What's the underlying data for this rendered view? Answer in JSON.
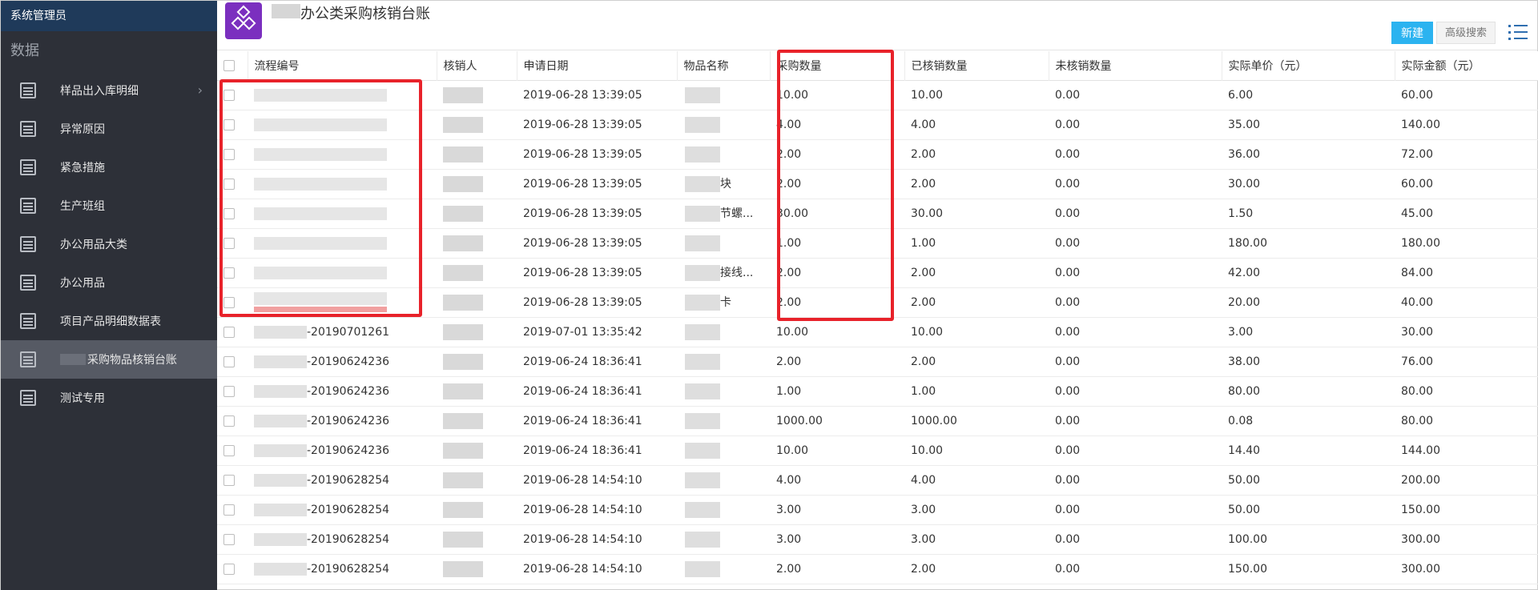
{
  "sidebar": {
    "user": "系统管理员",
    "section": "数据",
    "items": [
      {
        "label": "样品出入库明细",
        "has_arrow": true
      },
      {
        "label": "异常原因"
      },
      {
        "label": "紧急措施"
      },
      {
        "label": "生产班组"
      },
      {
        "label": "办公用品大类"
      },
      {
        "label": "办公用品"
      },
      {
        "label": "项目产品明细数据表"
      },
      {
        "label": "采购物品核销台账",
        "active": true
      },
      {
        "label": "测试专用"
      }
    ]
  },
  "header": {
    "title": "办公类采购核销台账",
    "new_label": "新建",
    "advanced_search_label": "高级搜索",
    "accent": "#2bb3f0",
    "logo_color": "#7b2fbf"
  },
  "table": {
    "columns": [
      "流程编号",
      "核销人",
      "申请日期",
      "物品名称",
      "采购数量",
      "已核销数量",
      "未核销数量",
      "实际单价（元）",
      "实际金额（元）"
    ],
    "rows": [
      {
        "code": "",
        "date": "2019-06-28 13:39:05",
        "item": "",
        "qty": "10.00",
        "done": "10.00",
        "pending": "0.00",
        "price": "6.00",
        "amount": "60.00"
      },
      {
        "code": "",
        "date": "2019-06-28 13:39:05",
        "item": "",
        "qty": "4.00",
        "done": "4.00",
        "pending": "0.00",
        "price": "35.00",
        "amount": "140.00"
      },
      {
        "code": "",
        "date": "2019-06-28 13:39:05",
        "item": "",
        "qty": "2.00",
        "done": "2.00",
        "pending": "0.00",
        "price": "36.00",
        "amount": "72.00"
      },
      {
        "code": "",
        "date": "2019-06-28 13:39:05",
        "item": "块",
        "qty": "2.00",
        "done": "2.00",
        "pending": "0.00",
        "price": "30.00",
        "amount": "60.00"
      },
      {
        "code": "",
        "date": "2019-06-28 13:39:05",
        "item": "节螺...",
        "qty": "30.00",
        "done": "30.00",
        "pending": "0.00",
        "price": "1.50",
        "amount": "45.00"
      },
      {
        "code": "",
        "date": "2019-06-28 13:39:05",
        "item": "",
        "qty": "1.00",
        "done": "1.00",
        "pending": "0.00",
        "price": "180.00",
        "amount": "180.00"
      },
      {
        "code": "",
        "date": "2019-06-28 13:39:05",
        "item": "接线...",
        "qty": "2.00",
        "done": "2.00",
        "pending": "0.00",
        "price": "42.00",
        "amount": "84.00"
      },
      {
        "code": "",
        "date": "2019-06-28 13:39:05",
        "item": "卡",
        "qty": "2.00",
        "done": "2.00",
        "pending": "0.00",
        "price": "20.00",
        "amount": "40.00"
      },
      {
        "code": "-20190701261",
        "date": "2019-07-01 13:35:42",
        "item": "",
        "qty": "10.00",
        "done": "10.00",
        "pending": "0.00",
        "price": "3.00",
        "amount": "30.00"
      },
      {
        "code": "-20190624236",
        "date": "2019-06-24 18:36:41",
        "item": "",
        "qty": "2.00",
        "done": "2.00",
        "pending": "0.00",
        "price": "38.00",
        "amount": "76.00"
      },
      {
        "code": "-20190624236",
        "date": "2019-06-24 18:36:41",
        "item": "",
        "qty": "1.00",
        "done": "1.00",
        "pending": "0.00",
        "price": "80.00",
        "amount": "80.00"
      },
      {
        "code": "-20190624236",
        "date": "2019-06-24 18:36:41",
        "item": "",
        "qty": "1000.00",
        "done": "1000.00",
        "pending": "0.00",
        "price": "0.08",
        "amount": "80.00"
      },
      {
        "code": "-20190624236",
        "date": "2019-06-24 18:36:41",
        "item": "",
        "qty": "10.00",
        "done": "10.00",
        "pending": "0.00",
        "price": "14.40",
        "amount": "144.00"
      },
      {
        "code": "-20190628254",
        "date": "2019-06-28 14:54:10",
        "item": "",
        "qty": "4.00",
        "done": "4.00",
        "pending": "0.00",
        "price": "50.00",
        "amount": "200.00"
      },
      {
        "code": "-20190628254",
        "date": "2019-06-28 14:54:10",
        "item": "",
        "qty": "3.00",
        "done": "3.00",
        "pending": "0.00",
        "price": "50.00",
        "amount": "150.00"
      },
      {
        "code": "-20190628254",
        "date": "2019-06-28 14:54:10",
        "item": "",
        "qty": "3.00",
        "done": "3.00",
        "pending": "0.00",
        "price": "100.00",
        "amount": "300.00"
      },
      {
        "code": "-20190628254",
        "date": "2019-06-28 14:54:10",
        "item": "",
        "qty": "2.00",
        "done": "2.00",
        "pending": "0.00",
        "price": "150.00",
        "amount": "300.00"
      }
    ]
  },
  "highlight_color": "#e8222a"
}
